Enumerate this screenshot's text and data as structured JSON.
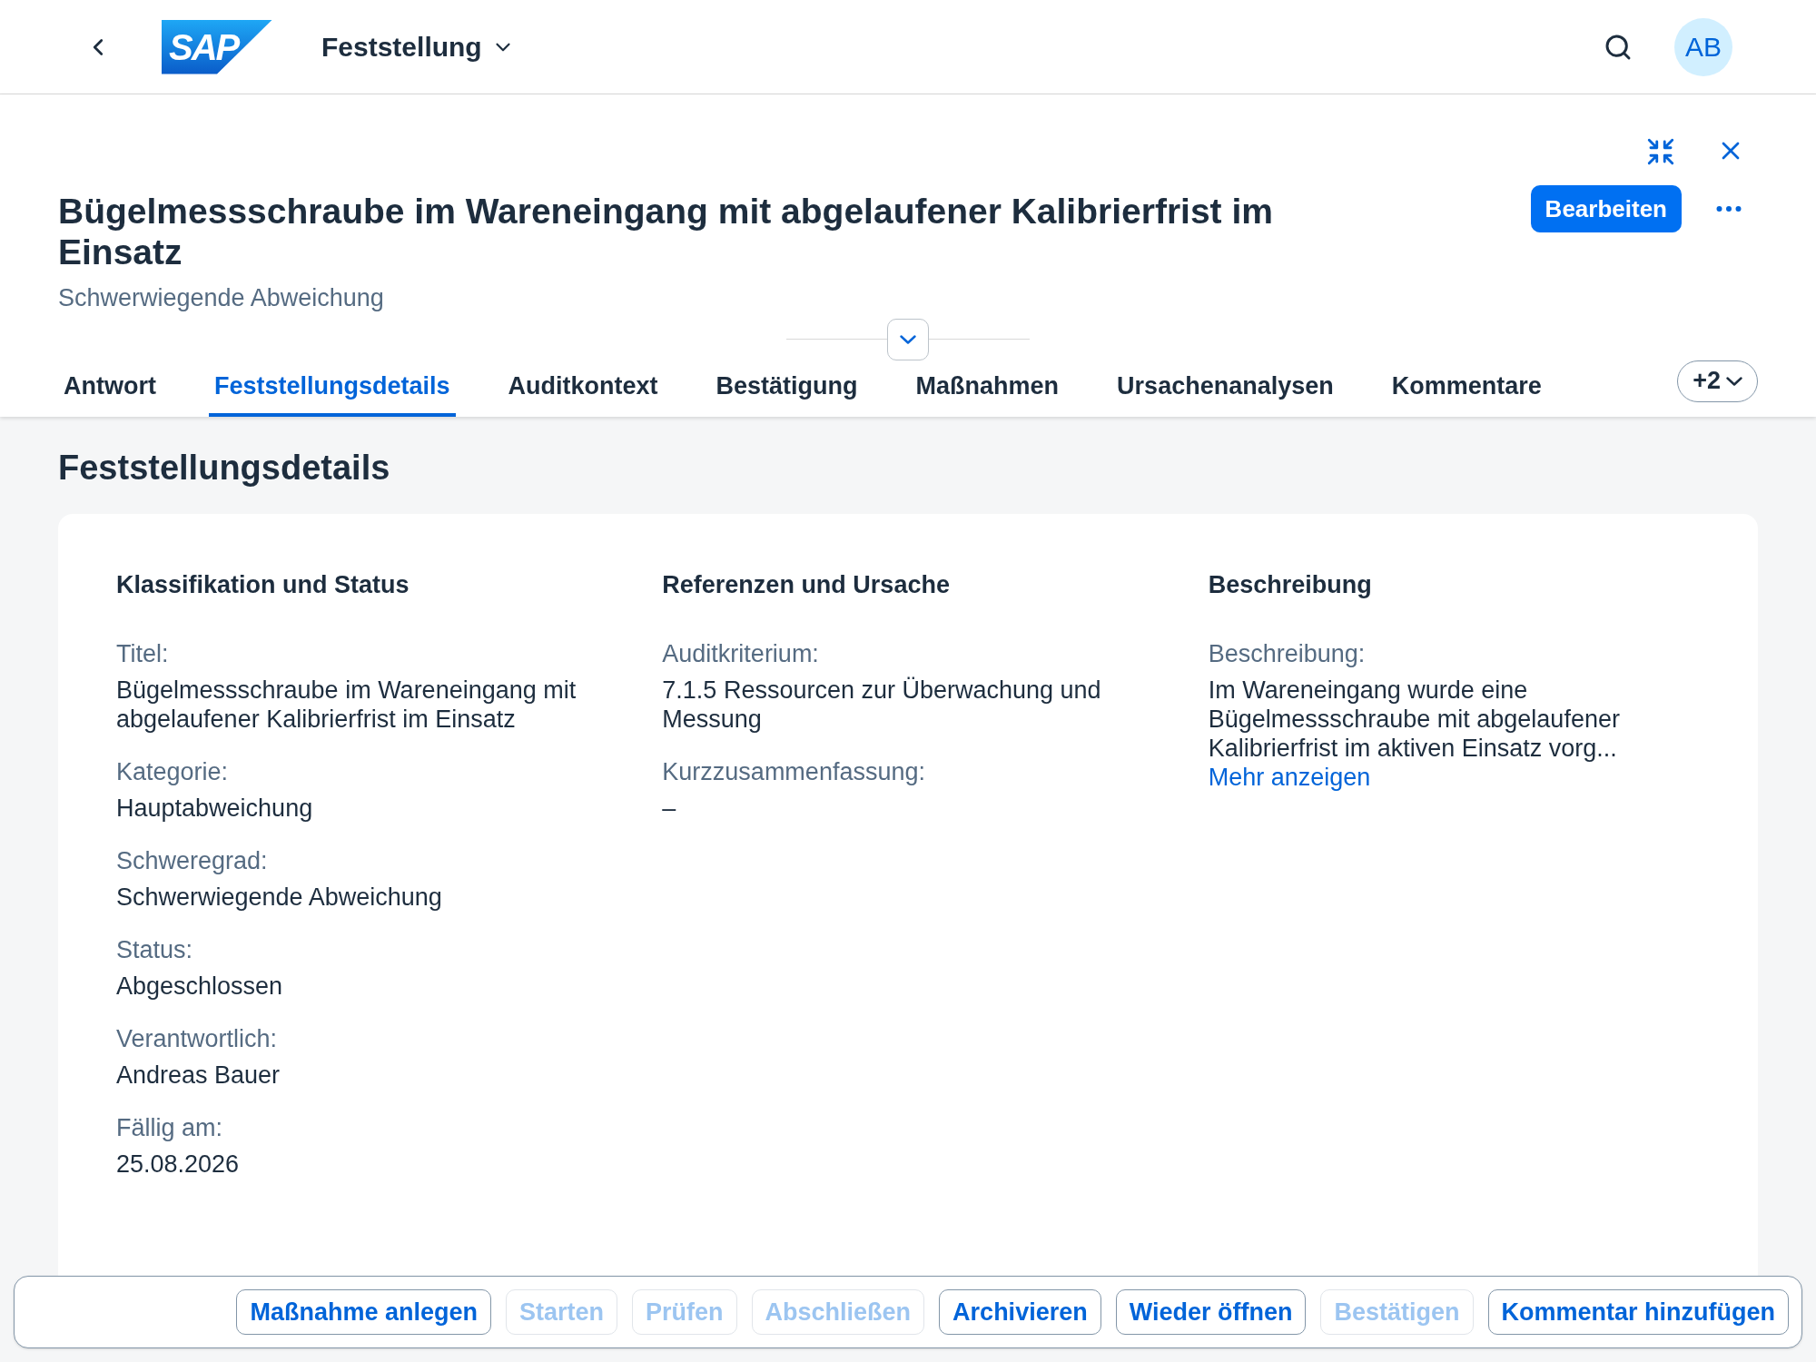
{
  "shell": {
    "logo": "SAP",
    "app_title": "Feststellung",
    "avatar": "AB"
  },
  "object": {
    "title": "Bügelmessschraube im Wareneingang mit abgelaufener Kalibrierfrist im Einsatz",
    "subtitle": "Schwerwiegende Abweichung",
    "edit_button": "Bearbeiten"
  },
  "tabs": [
    {
      "label": "Antwort",
      "selected": false
    },
    {
      "label": "Feststellungsdetails",
      "selected": true
    },
    {
      "label": "Auditkontext",
      "selected": false
    },
    {
      "label": "Bestätigung",
      "selected": false
    },
    {
      "label": "Maßnahmen",
      "selected": false
    },
    {
      "label": "Ursachenanalysen",
      "selected": false
    },
    {
      "label": "Kommentare",
      "selected": false
    }
  ],
  "more_tabs": "+2",
  "section": {
    "title": "Feststellungsdetails",
    "groups": [
      {
        "title": "Klassifikation und Status",
        "fields": [
          {
            "label": "Titel:",
            "value": "Bügelmessschraube im Wareneingang mit abgelaufener Kalibrierfrist im Einsatz"
          },
          {
            "label": "Kategorie:",
            "value": "Hauptabweichung"
          },
          {
            "label": "Schweregrad:",
            "value": "Schwerwiegende Abweichung"
          },
          {
            "label": "Status:",
            "value": "Abgeschlossen"
          },
          {
            "label": "Verantwortlich:",
            "value": "Andreas Bauer"
          },
          {
            "label": "Fällig am:",
            "value": "25.08.2026"
          }
        ]
      },
      {
        "title": "Referenzen und Ursache",
        "fields": [
          {
            "label": "Auditkriterium:",
            "value": "7.1.5 Ressourcen zur Überwachung und Messung"
          },
          {
            "label": "Kurzzusammenfassung:",
            "value": "–"
          }
        ]
      },
      {
        "title": "Beschreibung",
        "fields": [
          {
            "label": "Beschreibung:",
            "value": "Im Wareneingang wurde eine Bügelmessschraube mit abgelaufener Kalibrierfrist im aktiven Einsatz vorg...",
            "link": "Mehr anzeigen"
          }
        ]
      }
    ]
  },
  "footer": [
    {
      "label": "Maßnahme anlegen",
      "disabled": false
    },
    {
      "label": "Starten",
      "disabled": true
    },
    {
      "label": "Prüfen",
      "disabled": true
    },
    {
      "label": "Abschließen",
      "disabled": true
    },
    {
      "label": "Archivieren",
      "disabled": false
    },
    {
      "label": "Wieder öffnen",
      "disabled": false
    },
    {
      "label": "Bestätigen",
      "disabled": true
    },
    {
      "label": "Kommentar hinzufügen",
      "disabled": false
    }
  ]
}
